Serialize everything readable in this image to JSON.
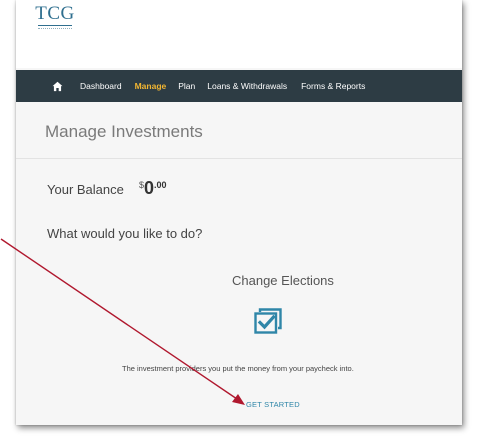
{
  "logo": {
    "text": "TCG"
  },
  "nav": {
    "home_icon": "home-icon",
    "items": [
      {
        "label": "Dashboard",
        "active": false
      },
      {
        "label": "Manage",
        "active": true
      },
      {
        "label": "Plan",
        "active": false
      },
      {
        "label": "Loans & Withdrawals",
        "active": false
      },
      {
        "label": "Forms & Reports",
        "active": false
      }
    ],
    "active_color": "#f2b632",
    "background_color": "#2d3c44"
  },
  "page": {
    "title": "Manage Investments",
    "balance_label": "Your Balance",
    "balance_currency": "$",
    "balance_whole": "0",
    "balance_cents": ".00",
    "question": "What would you like to do?"
  },
  "card": {
    "title": "Change Elections",
    "icon": "checklist-icon",
    "description": "The investment providers you put the money from your paycheck into.",
    "cta_label": "GET STARTED"
  },
  "annotation": {
    "arrow_color": "#b0182e"
  }
}
